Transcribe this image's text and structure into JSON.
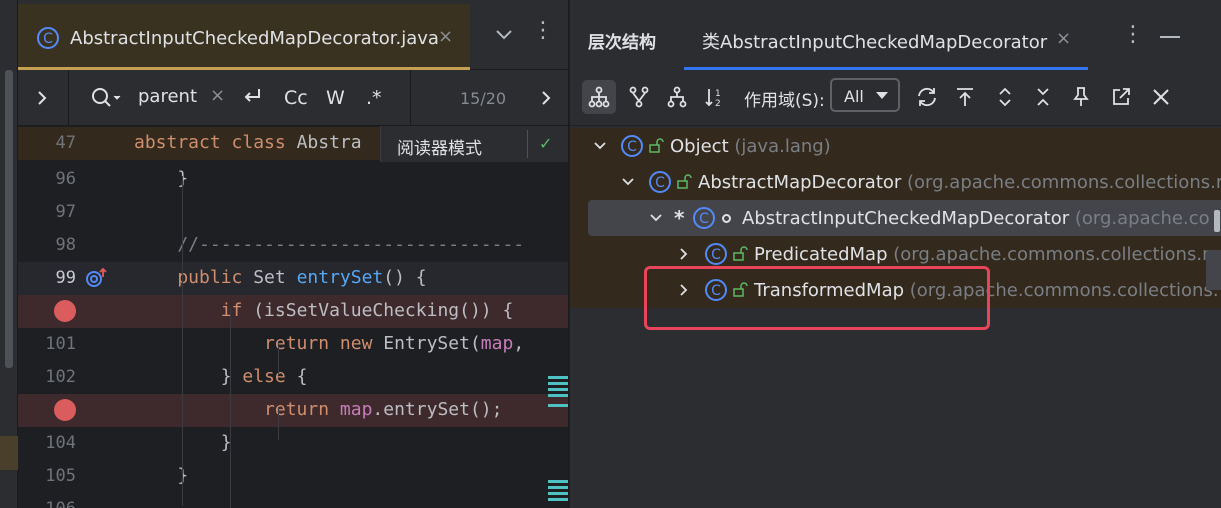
{
  "editor": {
    "file_tab": "AbstractInputCheckedMapDecorator.java",
    "close_glyph": "×",
    "more_glyph": "⋮",
    "find": {
      "query": "parent",
      "clear_glyph": "×",
      "options": [
        "Cc",
        "W",
        ".*"
      ],
      "match_count": "15/20"
    },
    "reader_mode": "阅读器模式",
    "check_glyph": "✓",
    "lines": [
      {
        "num": "47",
        "kind": "sticky",
        "tokens": [
          [
            "kw",
            "abstract "
          ],
          [
            "kw",
            "class "
          ],
          [
            "txt",
            "Abstra"
          ]
        ]
      },
      {
        "num": "96",
        "kind": "normal",
        "tokens": [
          [
            "txt",
            "    }"
          ]
        ]
      },
      {
        "num": "97",
        "kind": "normal",
        "tokens": []
      },
      {
        "num": "98",
        "kind": "normal",
        "tokens": [
          [
            "cmt",
            "    //------------------------------"
          ]
        ]
      },
      {
        "num": "99",
        "kind": "current",
        "tokens": [
          [
            "kw",
            "    public "
          ],
          [
            "txt",
            "Set "
          ],
          [
            "fn",
            "entrySet"
          ],
          [
            "txt",
            "() {"
          ]
        ]
      },
      {
        "num": "",
        "kind": "bp",
        "tokens": [
          [
            "kw",
            "        if "
          ],
          [
            "txt",
            "(isSetValueChecking()) {"
          ]
        ]
      },
      {
        "num": "101",
        "kind": "normal",
        "tokens": [
          [
            "kw",
            "            return new "
          ],
          [
            "txt",
            "EntrySet("
          ],
          [
            "fld",
            "map"
          ],
          [
            "txt",
            ","
          ]
        ]
      },
      {
        "num": "102",
        "kind": "normal",
        "tokens": [
          [
            "txt",
            "        } "
          ],
          [
            "kw",
            "else "
          ],
          [
            "txt",
            "{"
          ]
        ]
      },
      {
        "num": "",
        "kind": "bp",
        "tokens": [
          [
            "kw",
            "            return "
          ],
          [
            "fld",
            "map"
          ],
          [
            "txt",
            ".entrySet();"
          ]
        ]
      },
      {
        "num": "104",
        "kind": "normal",
        "tokens": [
          [
            "txt",
            "        }"
          ]
        ]
      },
      {
        "num": "105",
        "kind": "normal",
        "tokens": [
          [
            "txt",
            "    }"
          ]
        ]
      },
      {
        "num": "106",
        "kind": "normal",
        "tokens": []
      }
    ]
  },
  "hierarchy": {
    "title": "层次结构",
    "tab_label": "类AbstractInputCheckedMapDecorator",
    "close_glyph": "×",
    "more_glyph": "⋮",
    "scope_label": "作用域(S):",
    "scope_value": "All",
    "toolbar_icons": [
      "subtypes-hierarchy-icon",
      "supertypes-hierarchy-icon",
      "class-hierarchy-icon",
      "sort-alphabetically-icon",
      "refresh-icon",
      "scroll-to-source-icon",
      "expand-all-icon",
      "collapse-all-icon",
      "pin-icon",
      "open-in-window-icon",
      "close-icon"
    ],
    "tree": [
      {
        "name": "Object",
        "pkg": "(java.lang)",
        "expanded": true,
        "level": 0
      },
      {
        "name": "AbstractMapDecorator",
        "pkg": "(org.apache.commons.collections.m",
        "expanded": true,
        "level": 1
      },
      {
        "name": "AbstractInputCheckedMapDecorator",
        "pkg": "(org.apache.co",
        "expanded": true,
        "level": 2,
        "selected": true,
        "marker": "*"
      },
      {
        "name": "PredicatedMap",
        "pkg": "(org.apache.commons.collections.m",
        "expanded": false,
        "level": 3
      },
      {
        "name": "TransformedMap",
        "pkg": "(org.apache.commons.collections.",
        "expanded": false,
        "level": 3
      }
    ]
  }
}
